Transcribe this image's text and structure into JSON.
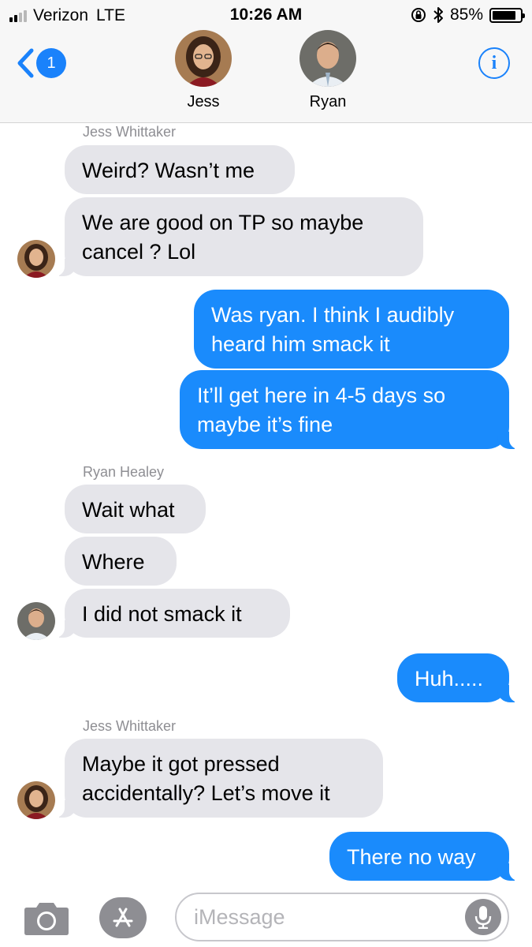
{
  "status_bar": {
    "carrier": "Verizon",
    "network": "LTE",
    "time": "10:26 AM",
    "battery_percent": "85%",
    "battery_level": 0.85,
    "signal_bars_active": 2,
    "signal_bars_total": 4
  },
  "header": {
    "back_badge": "1",
    "info_label": "i",
    "contacts": [
      {
        "name": "Jess"
      },
      {
        "name": "Ryan"
      }
    ]
  },
  "messages": [
    {
      "sender_label": "Jess Whittaker"
    },
    {
      "text": "Weird? Wasn’t me"
    },
    {
      "text_line1": "We are good on TP so maybe",
      "text_line2": "cancel ? Lol"
    },
    {
      "text_line1": "Was ryan. I think I audibly",
      "text_line2": "heard him smack it"
    },
    {
      "text_line1": "It’ll get here in 4-5 days so",
      "text_line2": "maybe it’s fine"
    },
    {
      "sender_label": "Ryan Healey"
    },
    {
      "text": "Wait what"
    },
    {
      "text": "Where"
    },
    {
      "text": "I did not smack it"
    },
    {
      "text": "Huh....."
    },
    {
      "sender_label": "Jess Whittaker"
    },
    {
      "text_line1": "Maybe it got pressed",
      "text_line2": "accidentally? Let’s move it"
    },
    {
      "text": "There no way"
    }
  ],
  "input_bar": {
    "placeholder": "iMessage"
  },
  "colors": {
    "outgoing_bubble": "#1a8bfc",
    "incoming_bubble": "#e5e5ea",
    "accent": "#1a82fb",
    "sender_label": "#8e8e93"
  },
  "icons": {
    "camera": "camera-icon",
    "app_store": "app-store-icon",
    "mic": "microphone-icon",
    "back": "chevron-left-icon",
    "info": "info-icon"
  }
}
